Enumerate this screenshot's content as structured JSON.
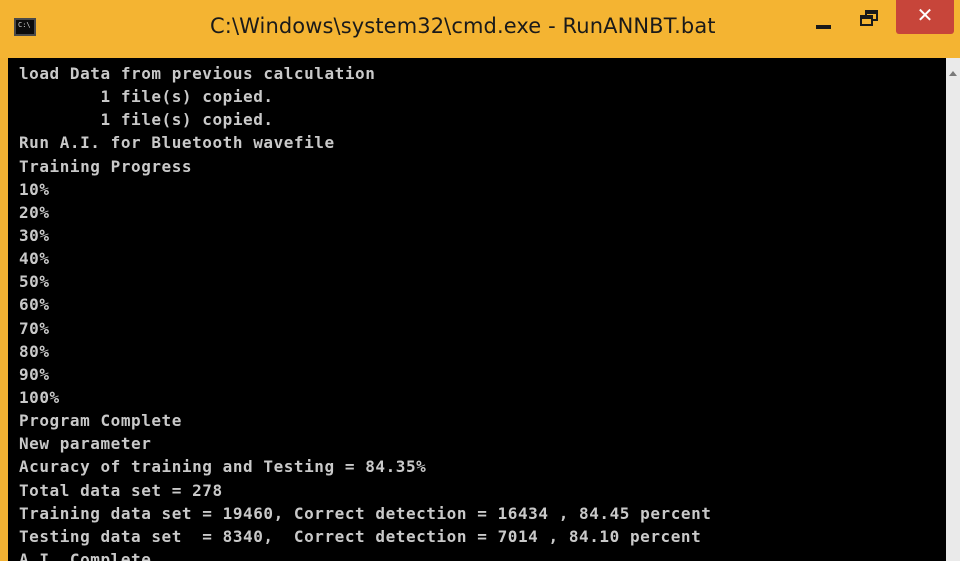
{
  "window": {
    "title": "C:\\Windows\\system32\\cmd.exe - RunANNBT.bat",
    "icon": "cmd-console-icon",
    "icon_glyph": "C:\\"
  },
  "controls": {
    "minimize_icon": "minimize-icon",
    "maximize_icon": "restore-icon",
    "close_icon": "close-icon",
    "close_glyph": "✕"
  },
  "colors": {
    "titlebar": "#f4b432",
    "close_button": "#c7453a",
    "console_background": "#000000",
    "console_text": "#c9c9c9"
  },
  "console": {
    "lines": [
      "load Data from previous calculation",
      "        1 file(s) copied.",
      "        1 file(s) copied.",
      "Run A.I. for Bluetooth wavefile",
      "Training Progress",
      "10%",
      "20%",
      "30%",
      "40%",
      "50%",
      "60%",
      "70%",
      "80%",
      "90%",
      "100%",
      "Program Complete",
      "New parameter",
      "Acuracy of training and Testing = 84.35%",
      "Total data set = 278",
      "Training data set = 19460, Correct detection = 16434 , 84.45 percent",
      "Testing data set  = 8340,  Correct detection = 7014 , 84.10 percent",
      "A.I. Complete"
    ]
  }
}
